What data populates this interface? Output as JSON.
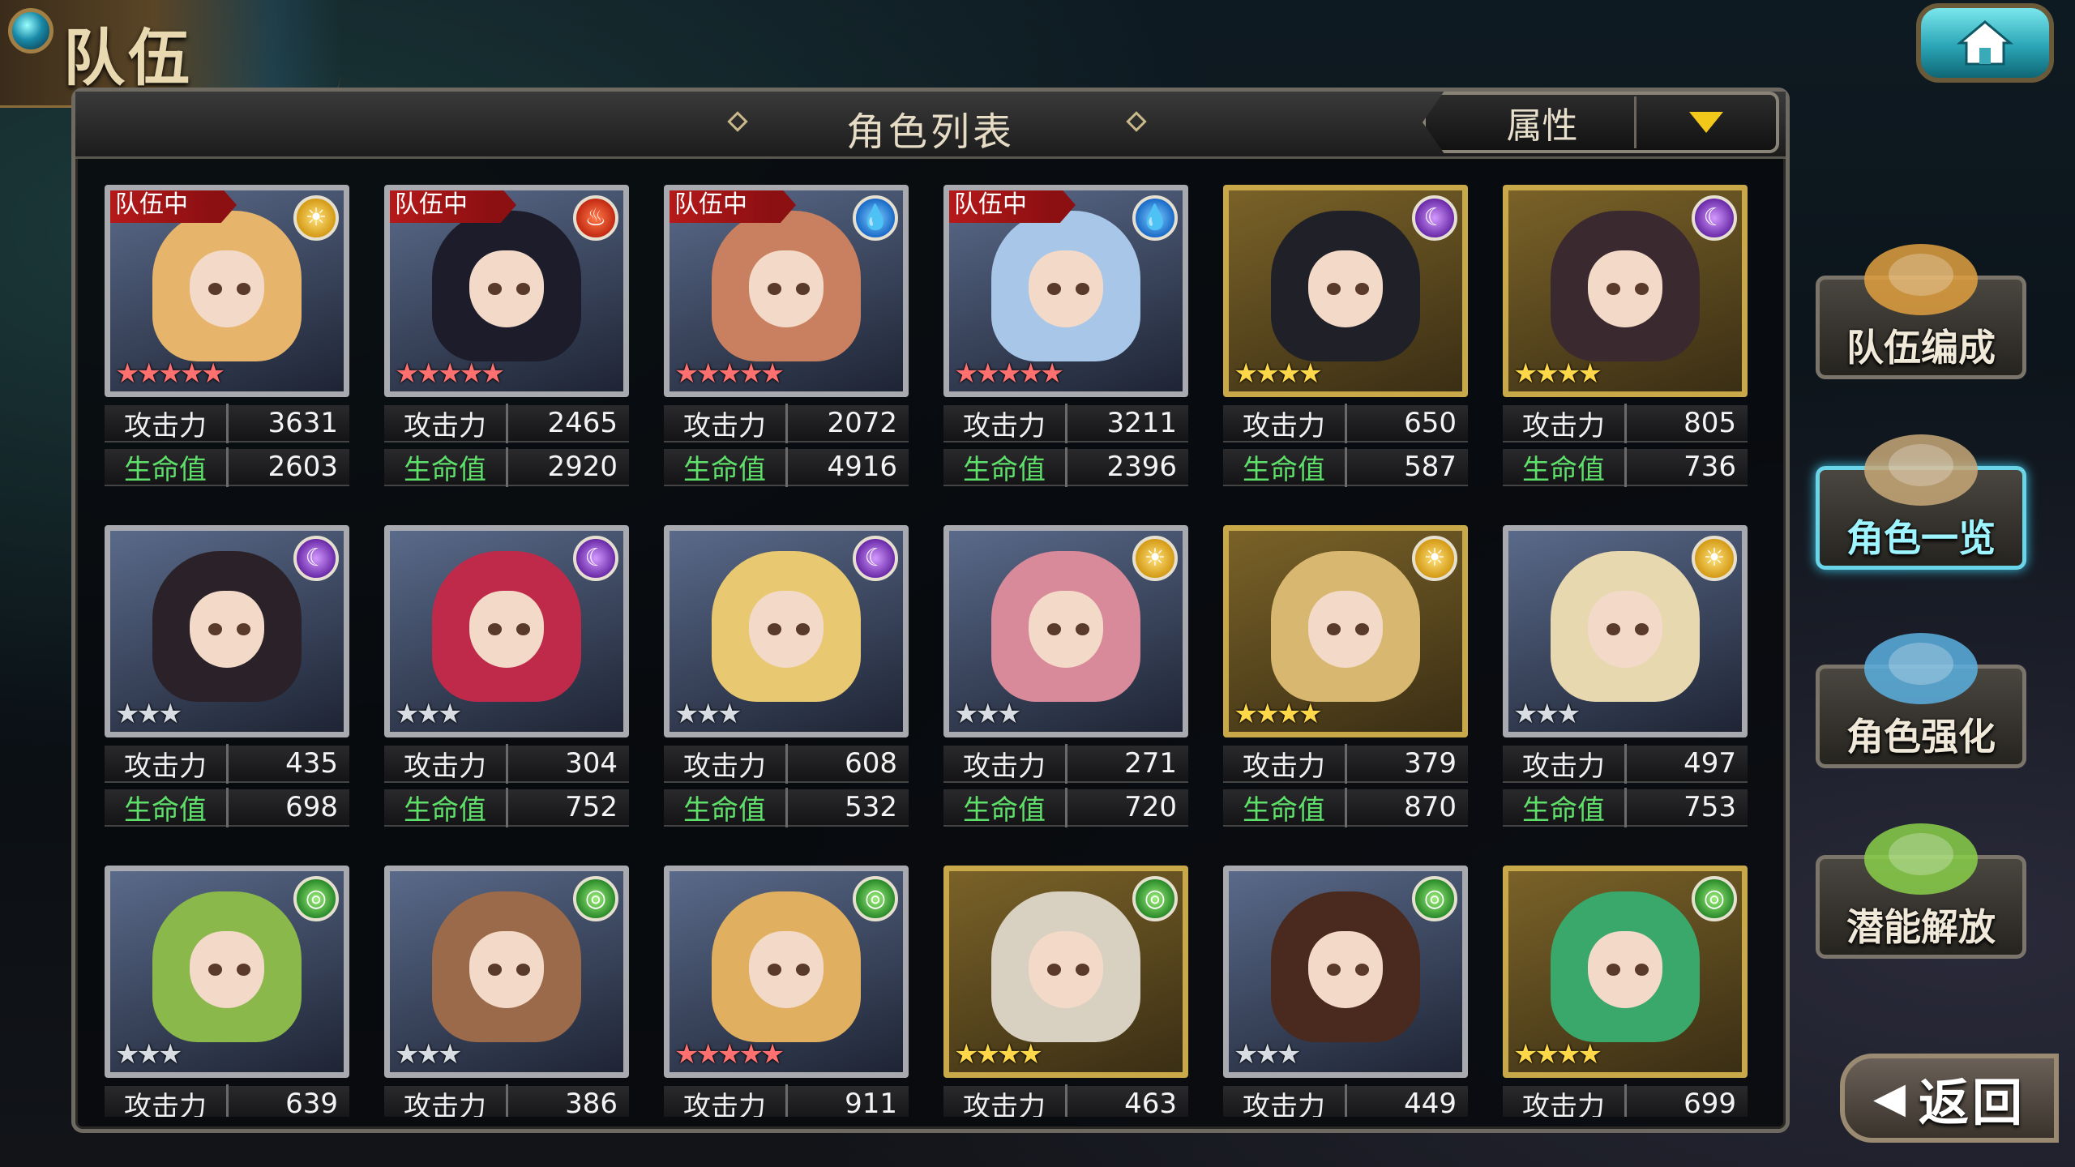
{
  "header": {
    "title": "队伍"
  },
  "panel": {
    "title": "角色列表",
    "filter_label": "属性"
  },
  "labels": {
    "attack": "攻击力",
    "hp": "生命值",
    "in_team": "队伍中"
  },
  "side_buttons": [
    {
      "label": "队伍编成",
      "active": false
    },
    {
      "label": "角色一览",
      "active": true
    },
    {
      "label": "角色强化",
      "active": false
    },
    {
      "label": "潜能解放",
      "active": false
    }
  ],
  "back_label": "返回",
  "characters": [
    {
      "in_team": true,
      "element": "sun",
      "rarity": 5,
      "attack": "3631",
      "hp": "2603",
      "frame": "silver",
      "hair": "#e6b46a"
    },
    {
      "in_team": true,
      "element": "fire",
      "rarity": 5,
      "attack": "2465",
      "hp": "2920",
      "frame": "silver",
      "hair": "#1c1c2a"
    },
    {
      "in_team": true,
      "element": "water",
      "rarity": 5,
      "attack": "2072",
      "hp": "4916",
      "frame": "silver",
      "hair": "#c98060"
    },
    {
      "in_team": true,
      "element": "water",
      "rarity": 5,
      "attack": "3211",
      "hp": "2396",
      "frame": "silver",
      "hair": "#a8c6e8"
    },
    {
      "in_team": false,
      "element": "moon",
      "rarity": 4,
      "attack": "650",
      "hp": "587",
      "frame": "gold",
      "hair": "#202028"
    },
    {
      "in_team": false,
      "element": "moon",
      "rarity": 4,
      "attack": "805",
      "hp": "736",
      "frame": "gold",
      "hair": "#3a2a30"
    },
    {
      "in_team": false,
      "element": "moon",
      "rarity": 3,
      "attack": "435",
      "hp": "698",
      "frame": "silver",
      "hair": "#2a2228"
    },
    {
      "in_team": false,
      "element": "moon",
      "rarity": 3,
      "attack": "304",
      "hp": "752",
      "frame": "silver",
      "hair": "#c02a4a"
    },
    {
      "in_team": false,
      "element": "moon",
      "rarity": 3,
      "attack": "608",
      "hp": "532",
      "frame": "silver",
      "hair": "#e8c870"
    },
    {
      "in_team": false,
      "element": "sun",
      "rarity": 3,
      "attack": "271",
      "hp": "720",
      "frame": "silver",
      "hair": "#d88a9a"
    },
    {
      "in_team": false,
      "element": "sun",
      "rarity": 4,
      "attack": "379",
      "hp": "870",
      "frame": "gold",
      "hair": "#d8b870"
    },
    {
      "in_team": false,
      "element": "sun",
      "rarity": 3,
      "attack": "497",
      "hp": "753",
      "frame": "silver",
      "hair": "#e8d8b0"
    },
    {
      "in_team": false,
      "element": "wind",
      "rarity": 3,
      "attack": "639",
      "hp": "",
      "frame": "silver",
      "hair": "#8ab84a"
    },
    {
      "in_team": false,
      "element": "wind",
      "rarity": 3,
      "attack": "386",
      "hp": "",
      "frame": "silver",
      "hair": "#9a6a4a"
    },
    {
      "in_team": false,
      "element": "wind",
      "rarity": 5,
      "attack": "911",
      "hp": "",
      "frame": "silver",
      "hair": "#e0b060"
    },
    {
      "in_team": false,
      "element": "wind",
      "rarity": 4,
      "attack": "463",
      "hp": "",
      "frame": "gold",
      "hair": "#d8d0c0"
    },
    {
      "in_team": false,
      "element": "wind",
      "rarity": 3,
      "attack": "449",
      "hp": "",
      "frame": "silver",
      "hair": "#4a2a1e"
    },
    {
      "in_team": false,
      "element": "wind",
      "rarity": 4,
      "attack": "699",
      "hp": "",
      "frame": "gold",
      "hair": "#3aa86a"
    }
  ],
  "icons": {
    "sun": "sun-icon",
    "fire": "fire-icon",
    "water": "water-icon",
    "moon": "moon-icon",
    "wind": "wind-icon"
  }
}
